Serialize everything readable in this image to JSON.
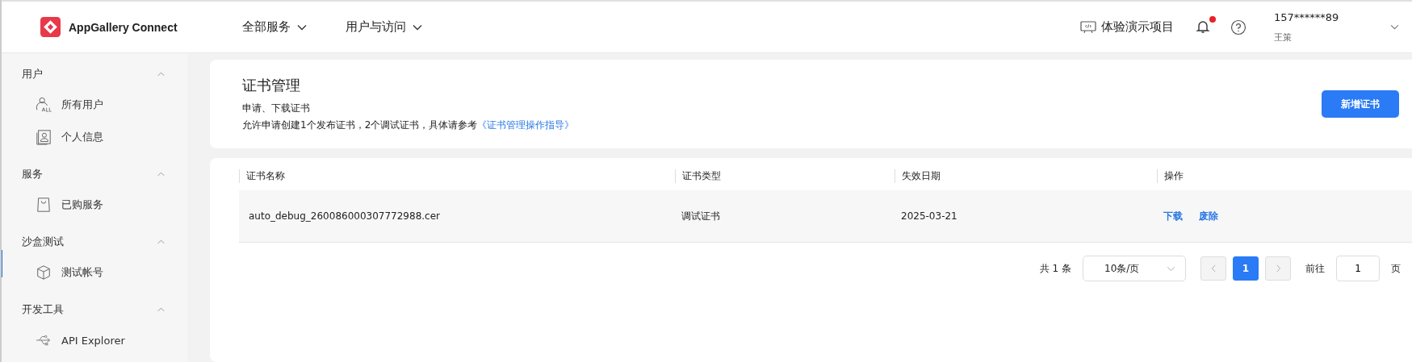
{
  "header": {
    "brand": "AppGallery Connect",
    "nav": [
      {
        "label": "全部服务"
      },
      {
        "label": "用户与访问"
      }
    ],
    "project": "体验演示项目",
    "notification_dot": true,
    "user": {
      "account": "157******89",
      "name": "王策"
    }
  },
  "sidebar": {
    "groups": [
      {
        "title": "用户",
        "expanded": true,
        "items": [
          {
            "label": "所有用户",
            "kind": "users",
            "selected": false
          },
          {
            "label": "个人信息",
            "kind": "profile",
            "selected": false
          }
        ]
      },
      {
        "title": "服务",
        "expanded": true,
        "items": [
          {
            "label": "已购服务",
            "kind": "bag",
            "selected": false
          }
        ]
      },
      {
        "title": "沙盒测试",
        "expanded": true,
        "items": [
          {
            "label": "测试帐号",
            "kind": "cube",
            "selected": true
          }
        ]
      },
      {
        "title": "开发工具",
        "expanded": true,
        "items": [
          {
            "label": "API Explorer",
            "kind": "usb",
            "selected": false
          }
        ]
      }
    ]
  },
  "page": {
    "title": "证书管理",
    "subtitle": "申请、下载证书",
    "note": "允许申请创建1个发布证书，2个调试证书，具体请参考",
    "guide_link": "《证书管理操作指导》",
    "add_button": "新增证书"
  },
  "table": {
    "columns": [
      "证书名称",
      "证书类型",
      "失效日期",
      "操作"
    ],
    "rows": [
      {
        "name": "auto_debug_260086000307772988.cer",
        "type": "调试证书",
        "expires": "2025-03-21",
        "actions": [
          "下载",
          "废除"
        ]
      }
    ]
  },
  "pagination": {
    "total": "共 1 条",
    "page_size": "10条/页",
    "pages": [
      {
        "label": "1",
        "selected": true
      }
    ],
    "goto_label": "前往",
    "goto_value": "1",
    "page_suffix": "页"
  }
}
